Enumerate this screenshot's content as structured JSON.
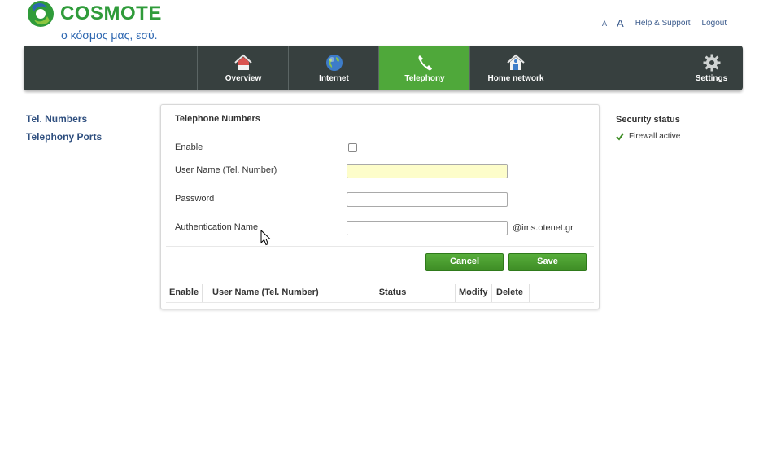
{
  "brand": {
    "name": "COSMOTE",
    "tagline": "ο κόσμος μας, εσύ."
  },
  "toplinks": {
    "font_small": "A",
    "font_large": "A",
    "help": "Help & Support",
    "logout": "Logout"
  },
  "nav": {
    "items": [
      {
        "label": "Overview",
        "icon": "home-icon"
      },
      {
        "label": "Internet",
        "icon": "globe-icon"
      },
      {
        "label": "Telephony",
        "icon": "phone-icon",
        "active": true
      },
      {
        "label": "Home network",
        "icon": "home-network-icon"
      },
      {
        "label": "Settings",
        "icon": "gear-icon"
      }
    ],
    "active_color": "#4fa83a",
    "bar_color": "#37403f"
  },
  "sidebar": {
    "items": [
      {
        "label": "Tel. Numbers"
      },
      {
        "label": "Telephony Ports"
      }
    ]
  },
  "panel": {
    "title": "Telephone Numbers",
    "fields": {
      "enable_label": "Enable",
      "enable_checked": false,
      "username_label": "User Name (Tel. Number)",
      "username_value": "",
      "password_label": "Password",
      "password_value": "",
      "auth_label": "Authentication Name",
      "auth_value": "",
      "auth_suffix": "@ims.otenet.gr"
    },
    "buttons": {
      "cancel": "Cancel",
      "save": "Save"
    },
    "table": {
      "columns": [
        "Enable",
        "User Name (Tel. Number)",
        "Status",
        "Modify",
        "Delete"
      ],
      "rows": []
    }
  },
  "security": {
    "title": "Security status",
    "firewall": "Firewall active"
  }
}
